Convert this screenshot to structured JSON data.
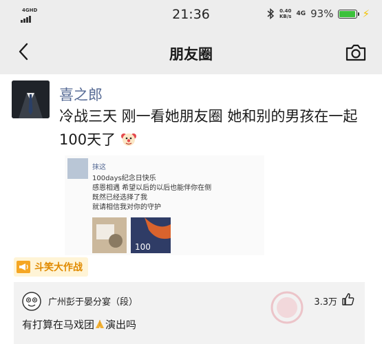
{
  "status_bar": {
    "network_type": "4GHD",
    "time": "21:36",
    "speed_value": "0.40",
    "speed_unit": "KB/s",
    "network_4g": "4G",
    "battery_percent": "93%",
    "battery_level": 0.93
  },
  "nav": {
    "title": "朋友圈"
  },
  "post": {
    "username": "喜之郎",
    "text": "冷战三天 刚一看她朋友圈 她和别的男孩在一起100天了"
  },
  "embedded": {
    "name": "抹这",
    "lines": [
      "100days纪念日快乐",
      "感恩相遇 希望以后的以后也能伴你在侧",
      "既然已经选择了我",
      "就请相信我对你的守护"
    ],
    "image_number": "100"
  },
  "tag": {
    "label": "斗笑大作战"
  },
  "comment": {
    "username": "广州彭于晏分宴（段）",
    "likes": "3.3万",
    "text_before": "有打算在马戏团",
    "text_after": "演出吗"
  },
  "icons": {
    "back": "back-arrow-icon",
    "camera": "camera-icon",
    "thumb": "thumbs-up-icon",
    "megaphone": "megaphone-icon"
  },
  "colors": {
    "username_blue": "#576b95",
    "tag_orange": "#e08a00",
    "battery_green": "#3cc13b"
  }
}
